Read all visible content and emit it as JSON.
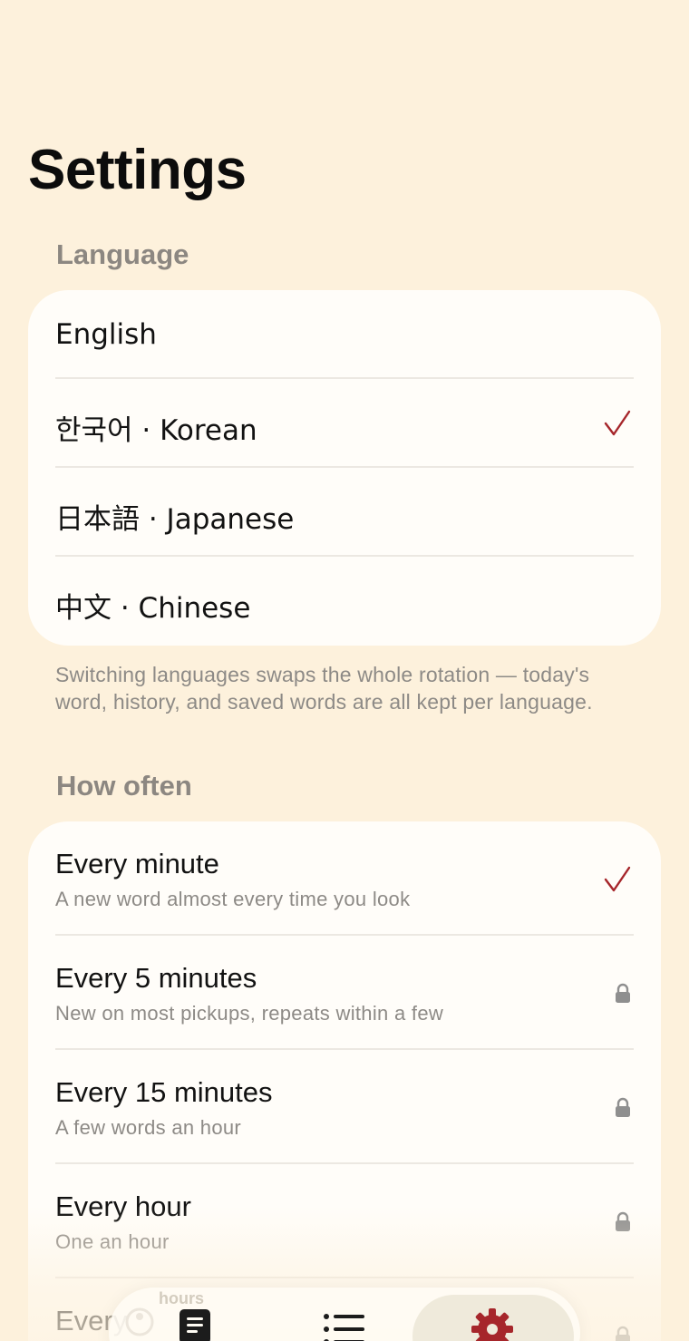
{
  "header": {
    "title": "Settings"
  },
  "language": {
    "section_label": "Language",
    "items": [
      {
        "label": "English",
        "selected": false
      },
      {
        "label": "한국어 · Korean",
        "selected": true
      },
      {
        "label": "日本語 · Japanese",
        "selected": false
      },
      {
        "label": "中文 · Chinese",
        "selected": false
      }
    ],
    "footnote": "Switching languages swaps the whole rotation — today's word, history, and saved words are all kept per language."
  },
  "frequency": {
    "section_label": "How often",
    "items": [
      {
        "title": "Every minute",
        "subtitle": "A new word almost every time you look",
        "state": "selected"
      },
      {
        "title": "Every 5 minutes",
        "subtitle": "New on most pickups, repeats within a few",
        "state": "locked"
      },
      {
        "title": "Every 15 minutes",
        "subtitle": "A few words an hour",
        "state": "locked"
      },
      {
        "title": "Every hour",
        "subtitle": "One an hour",
        "state": "locked"
      },
      {
        "title": "Every",
        "subtitle": "",
        "state": "locked"
      }
    ]
  },
  "tabbar": {
    "items": [
      {
        "icon": "notebook-icon",
        "active": false
      },
      {
        "icon": "list-icon",
        "active": false
      },
      {
        "icon": "gear-icon",
        "active": true
      }
    ],
    "ghost_text": "hours"
  },
  "colors": {
    "background": "#fdf1dc",
    "card": "#fffdf9",
    "accent": "#a6262b",
    "muted": "#8c8781"
  }
}
